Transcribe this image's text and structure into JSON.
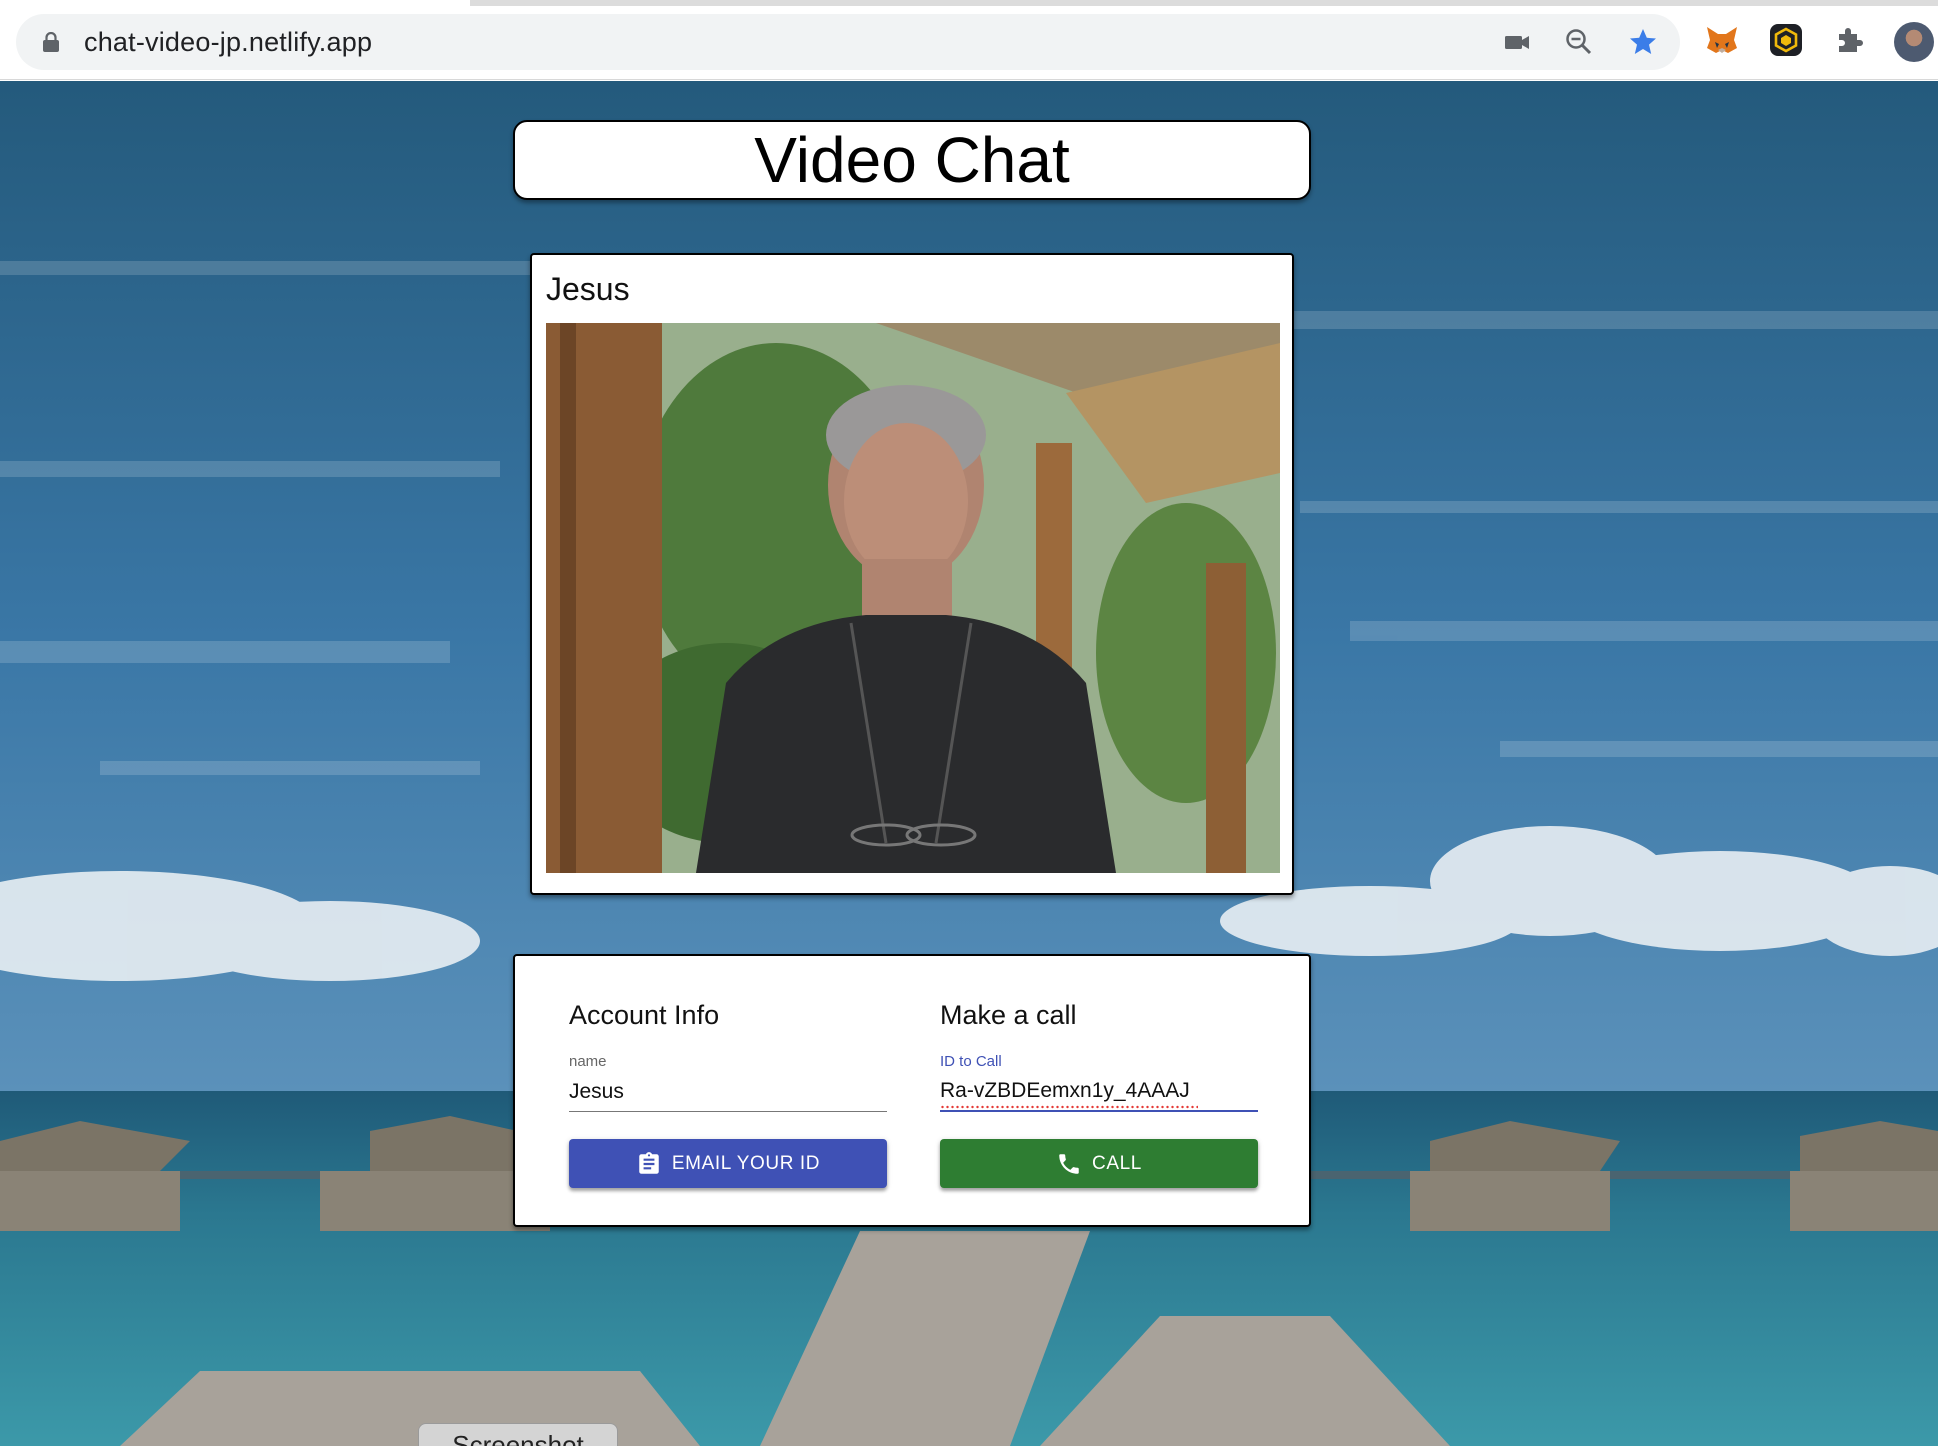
{
  "browser": {
    "url": "chat-video-jp.netlify.app",
    "icons": [
      "lock-icon",
      "video-camera-icon",
      "zoom-out-icon",
      "bookmark-star-icon",
      "metamask-fox-icon",
      "binance-wallet-icon",
      "extensions-puzzle-icon",
      "profile-avatar"
    ]
  },
  "page": {
    "title": "Video Chat",
    "video": {
      "name": "Jesus"
    },
    "account": {
      "heading": "Account Info",
      "name_label": "name",
      "name_value": "Jesus",
      "email_button": "EMAIL YOUR ID",
      "email_icon": "clipboard-icon"
    },
    "call": {
      "heading": "Make a call",
      "id_label": "ID to Call",
      "id_value": "Ra-vZBDEemxn1y_4AAAJ",
      "call_button": "CALL",
      "call_icon": "phone-icon"
    },
    "screenshot_button": "Screenshot"
  },
  "colors": {
    "primary": "#3f51b5",
    "success": "#2e7d32",
    "star_blue": "#3b7de8",
    "sea": "#2f7e93"
  }
}
